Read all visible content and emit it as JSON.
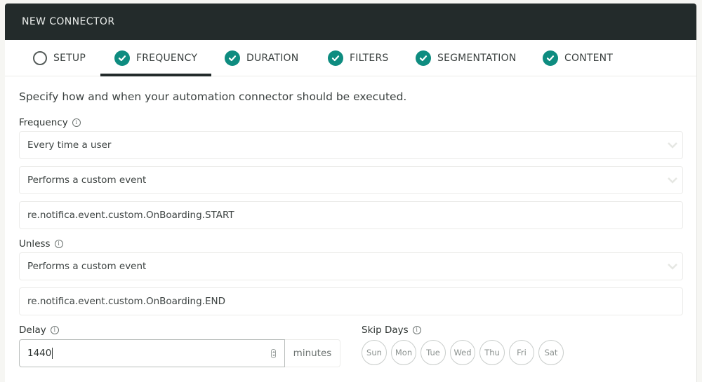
{
  "modal": {
    "title": "NEW CONNECTOR"
  },
  "tabs": [
    {
      "label": "SETUP",
      "status": "incomplete",
      "icon": "empty-circle-icon"
    },
    {
      "label": "FREQUENCY",
      "status": "complete",
      "icon": "check-circle-icon",
      "active": true
    },
    {
      "label": "DURATION",
      "status": "complete",
      "icon": "check-circle-icon"
    },
    {
      "label": "FILTERS",
      "status": "complete",
      "icon": "check-circle-icon"
    },
    {
      "label": "SEGMENTATION",
      "status": "complete",
      "icon": "check-circle-icon"
    },
    {
      "label": "CONTENT",
      "status": "complete",
      "icon": "check-circle-icon"
    }
  ],
  "intro": "Specify how and when your automation connector should be executed.",
  "frequency": {
    "label": "Frequency",
    "trigger_select": "Every time a user",
    "event_select": "Performs a custom event",
    "event_name": "re.notifica.event.custom.OnBoarding.START"
  },
  "unless": {
    "label": "Unless",
    "event_select": "Performs a custom event",
    "event_name": "re.notifica.event.custom.OnBoarding.END"
  },
  "delay": {
    "label": "Delay",
    "value": "1440",
    "unit": "minutes"
  },
  "skip_days": {
    "label": "Skip Days",
    "days": [
      "Sun",
      "Mon",
      "Tue",
      "Wed",
      "Thu",
      "Fri",
      "Sat"
    ]
  },
  "colors": {
    "header_bg": "#232b2b",
    "accent": "#0e8c80"
  }
}
